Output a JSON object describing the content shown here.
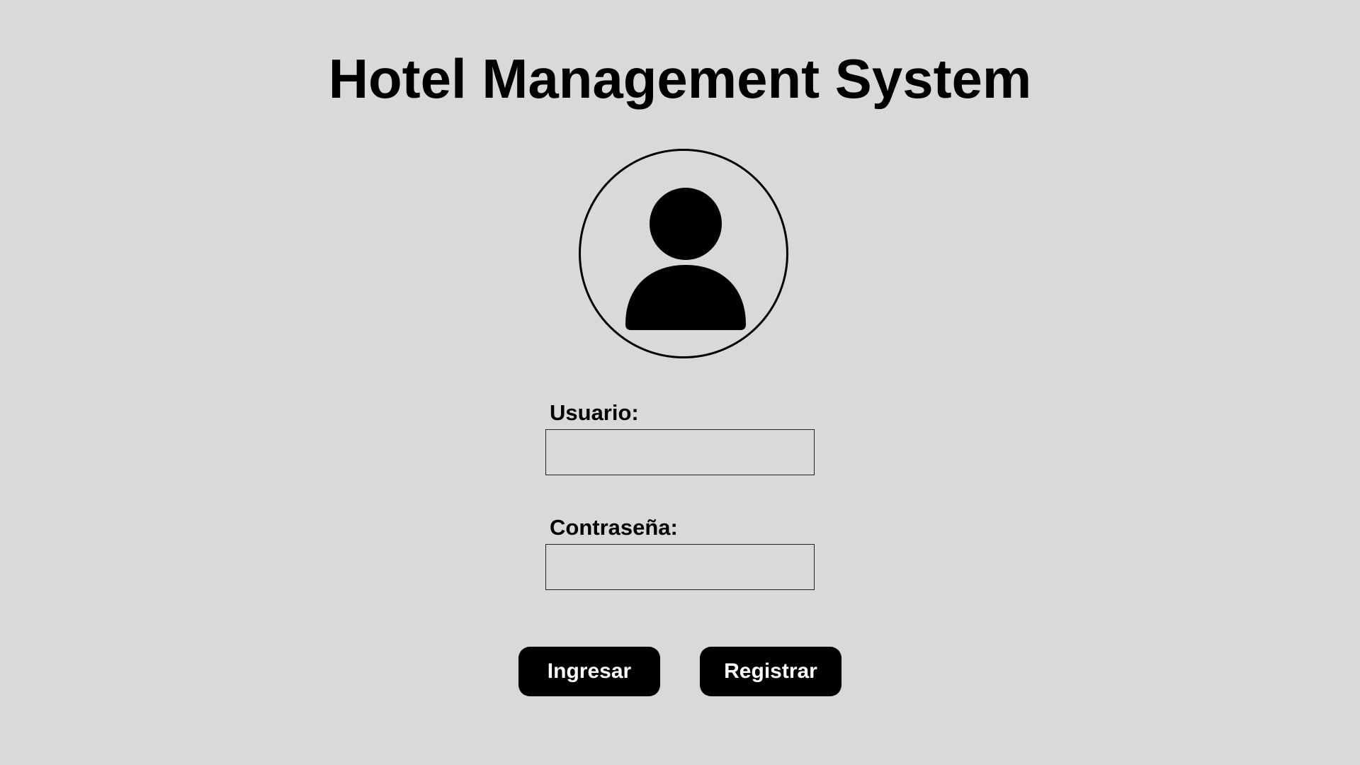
{
  "header": {
    "title": "Hotel Management System"
  },
  "avatar": {
    "icon": "user-icon"
  },
  "form": {
    "username_label": "Usuario:",
    "username_value": "",
    "password_label": "Contraseña:",
    "password_value": ""
  },
  "actions": {
    "login_label": "Ingresar",
    "register_label": "Registrar"
  },
  "colors": {
    "background": "#d9d9d9",
    "foreground": "#000000",
    "button_text": "#ffffff"
  }
}
